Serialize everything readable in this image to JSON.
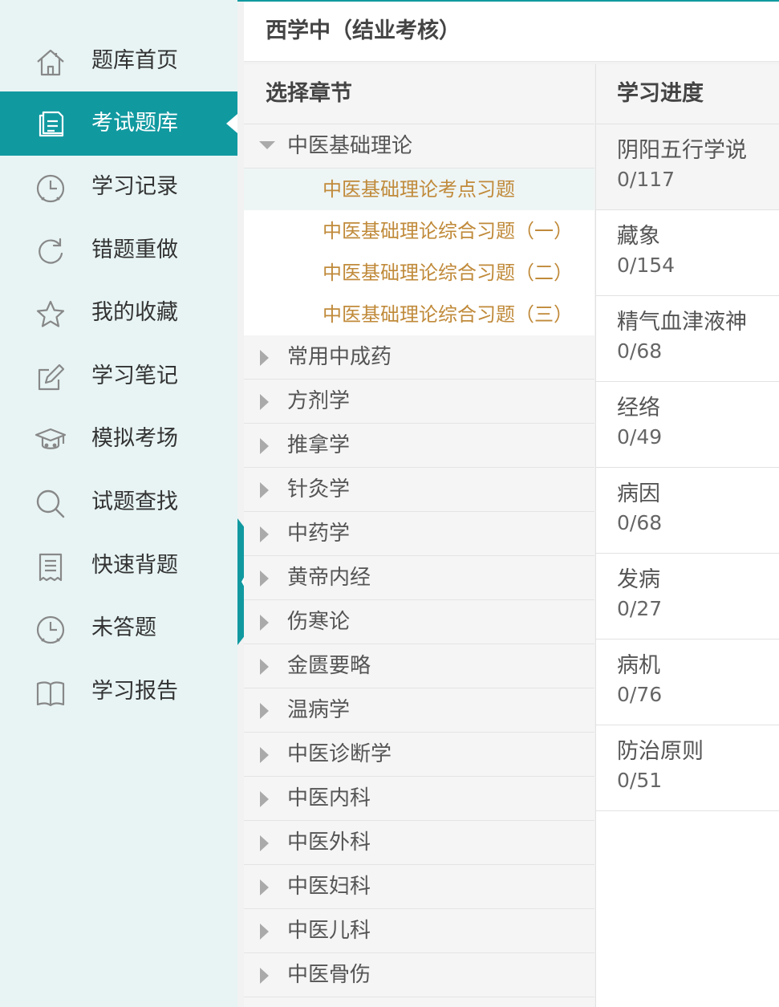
{
  "sidebar": {
    "items": [
      {
        "label": "题库首页",
        "icon": "home-icon",
        "active": false
      },
      {
        "label": "考试题库",
        "icon": "document-icon",
        "active": true
      },
      {
        "label": "学习记录",
        "icon": "clock-icon",
        "active": false
      },
      {
        "label": "错题重做",
        "icon": "refresh-icon",
        "active": false
      },
      {
        "label": "我的收藏",
        "icon": "star-icon",
        "active": false
      },
      {
        "label": "学习笔记",
        "icon": "edit-icon",
        "active": false
      },
      {
        "label": "模拟考场",
        "icon": "graduation-cap-icon",
        "active": false
      },
      {
        "label": "试题查找",
        "icon": "search-icon",
        "active": false
      },
      {
        "label": "快速背题",
        "icon": "receipt-icon",
        "active": false
      },
      {
        "label": "未答题",
        "icon": "clock-icon",
        "active": false
      },
      {
        "label": "学习报告",
        "icon": "book-icon",
        "active": false
      }
    ]
  },
  "header": {
    "title": "西学中（结业考核）"
  },
  "chapters": {
    "heading": "选择章节",
    "expanded": {
      "name": "中医基础理论",
      "subs": [
        "中医基础理论考点习题",
        "中医基础理论综合习题（一）",
        "中医基础理论综合习题（二）",
        "中医基础理论综合习题（三）"
      ]
    },
    "collapsed": [
      "常用中成药",
      "方剂学",
      "推拿学",
      "针灸学",
      "中药学",
      "黄帝内经",
      "伤寒论",
      "金匮要略",
      "温病学",
      "中医诊断学",
      "中医内科",
      "中医外科",
      "中医妇科",
      "中医儿科",
      "中医骨伤"
    ]
  },
  "progress": {
    "heading": "学习进度",
    "items": [
      {
        "name": "阴阳五行学说",
        "count": "0/117"
      },
      {
        "name": "藏象",
        "count": "0/154"
      },
      {
        "name": "精气血津液神",
        "count": "0/68"
      },
      {
        "name": "经络",
        "count": "0/49"
      },
      {
        "name": "病因",
        "count": "0/68"
      },
      {
        "name": "发病",
        "count": "0/27"
      },
      {
        "name": "病机",
        "count": "0/76"
      },
      {
        "name": "防治原则",
        "count": "0/51"
      }
    ]
  },
  "colors": {
    "accent": "#1199a0",
    "sidebar_bg": "#e8f4f4",
    "sub_text": "#c08a3a"
  }
}
